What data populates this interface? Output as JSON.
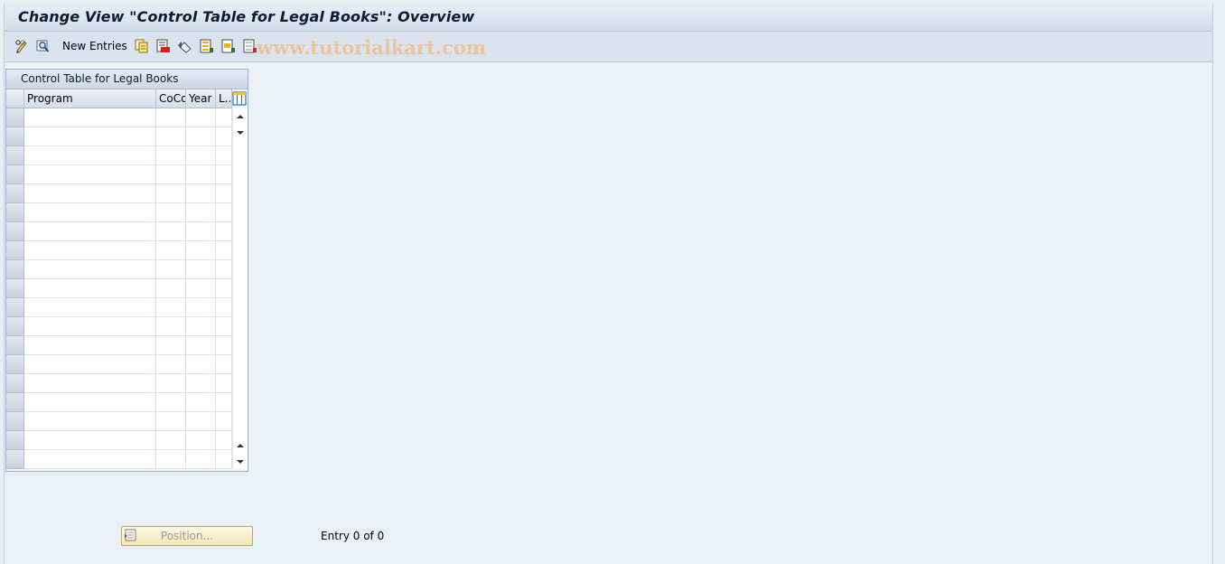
{
  "window": {
    "title": "Change View \"Control Table for Legal Books\": Overview"
  },
  "toolbar": {
    "buttons": [
      "display-change-icon",
      "details-icon",
      "copy-as-icon",
      "delete-icon",
      "undo-change-icon",
      "select-all-icon",
      "select-block-icon",
      "deselect-all-icon"
    ],
    "new_entries_label": "New Entries"
  },
  "watermark": "www.tutorialkart.com",
  "table": {
    "title": "Control Table for Legal Books",
    "columns": [
      "Program",
      "CoCd",
      "Year",
      "L.."
    ],
    "visible_rows": 19,
    "rows": []
  },
  "footer": {
    "position_label": "Position...",
    "entry_info": "Entry 0 of 0"
  },
  "colors": {
    "background": "#ebf0f7",
    "title_text": "#0b1d33",
    "position_button": "#f3e7b4"
  }
}
